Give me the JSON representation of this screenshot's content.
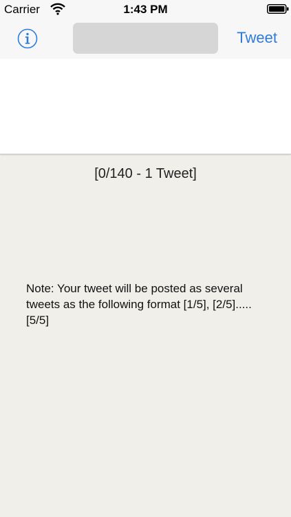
{
  "status_bar": {
    "carrier": "Carrier",
    "time": "1:43 PM"
  },
  "nav_bar": {
    "info_icon": "info-circle-icon",
    "title_field_value": "",
    "tweet_label": "Tweet"
  },
  "compose": {
    "text_value": ""
  },
  "counter": {
    "text": "[0/140 - 1 Tweet]"
  },
  "note": {
    "text": "Note: Your tweet will be posted as several tweets as the following format [1/5], [2/5].....[5/5]"
  },
  "colors": {
    "accent": "#2f7bd8",
    "background": "#f0efea",
    "nav_background": "#f7f7f7",
    "title_field": "#d6d6d6"
  }
}
